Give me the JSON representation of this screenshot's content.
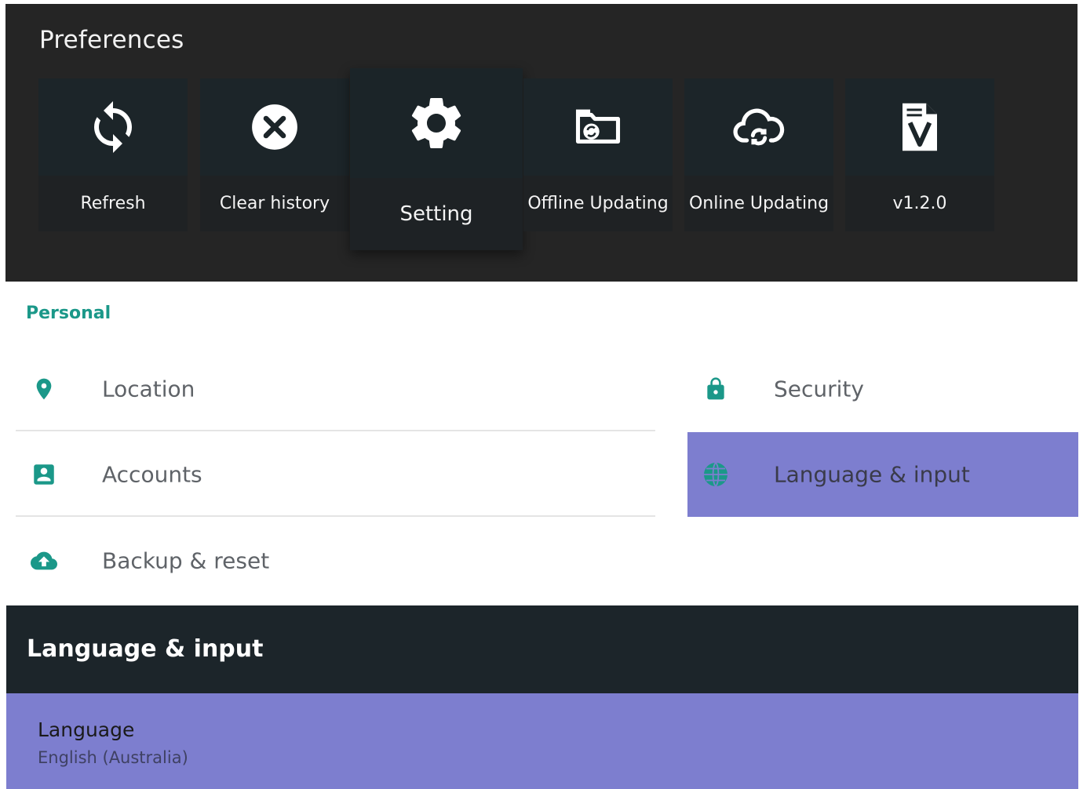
{
  "header": {
    "title": "Preferences",
    "background": "#252525"
  },
  "tiles": [
    {
      "label": "Refresh",
      "icon": "refresh-icon"
    },
    {
      "label": "Clear history",
      "icon": "clear-icon"
    },
    {
      "label": "Setting",
      "icon": "gear-icon",
      "focused": true
    },
    {
      "label": "Offline Updating",
      "icon": "folder-sync-icon"
    },
    {
      "label": "Online Updating",
      "icon": "cloud-sync-icon"
    },
    {
      "label": "v1.2.0",
      "icon": "version-icon"
    }
  ],
  "personal": {
    "section_label": "Personal",
    "accent": "#1b9889",
    "items": [
      {
        "label": "Location",
        "icon": "location-pin-icon"
      },
      {
        "label": "Security",
        "icon": "lock-icon"
      },
      {
        "label": "Accounts",
        "icon": "account-icon"
      },
      {
        "label": "Language & input",
        "icon": "globe-icon",
        "selected": true
      },
      {
        "label": "Backup & reset",
        "icon": "cloud-upload-icon"
      }
    ],
    "selected_color": "#7d7ecf"
  },
  "language_panel": {
    "title": "Language & input",
    "preference": {
      "title": "Language",
      "summary": "English (Australia)"
    }
  }
}
